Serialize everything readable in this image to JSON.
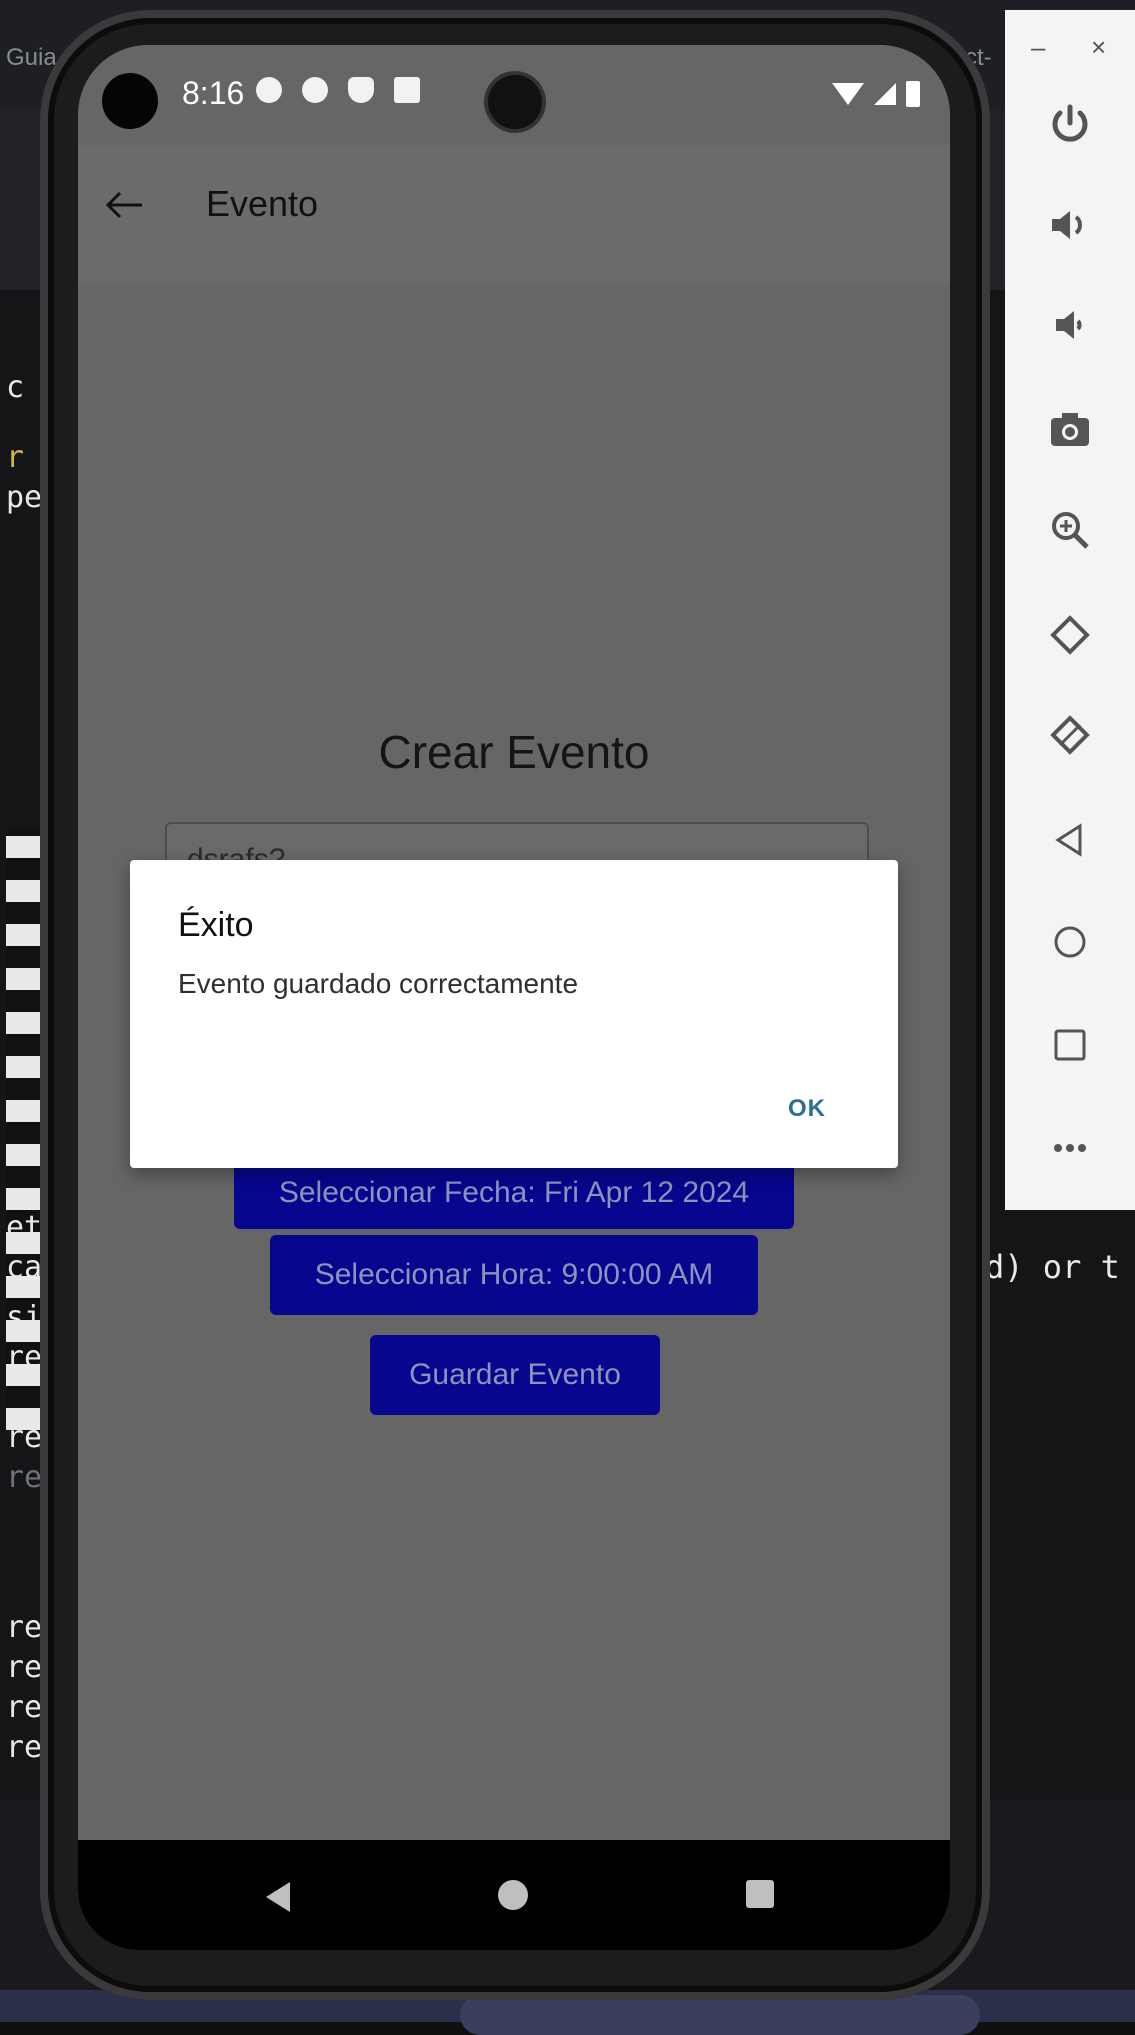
{
  "ide": {
    "tab_left": "Guia",
    "tab_right": "ct-",
    "side_char": "t",
    "code_lines": [
      "c",
      "r",
      "pe",
      "et",
      "ca",
      "si",
      "re",
      "re",
      "re",
      "re",
      "re",
      "re",
      "re"
    ],
    "code_right": "d) or t"
  },
  "emulator": {
    "minimize": "–",
    "close": "×",
    "tools": [
      "power-icon",
      "volume-up-icon",
      "volume-down-icon",
      "camera-icon",
      "zoom-icon",
      "rotate-left-icon",
      "rotate-right-icon",
      "back-icon",
      "home-icon",
      "overview-icon",
      "more-icon"
    ]
  },
  "status": {
    "time": "8:16"
  },
  "appbar": {
    "title": "Evento"
  },
  "page": {
    "heading": "Crear Evento",
    "name_value": "dsrafs?"
  },
  "buttons": {
    "fecha": "Seleccionar Fecha: Fri Apr 12 2024",
    "hora": "Seleccionar Hora: 9:00:00 AM",
    "guardar": "Guardar Evento"
  },
  "dialog": {
    "title": "Éxito",
    "message": "Evento guardado correctamente",
    "ok": "OK"
  }
}
